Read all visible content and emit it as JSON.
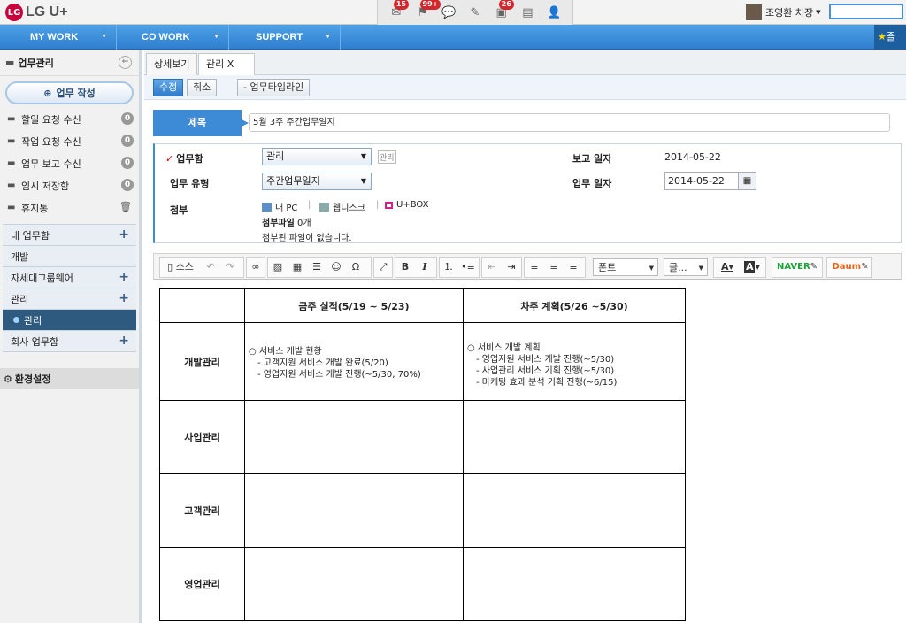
{
  "brand": {
    "logo_mark": "LG",
    "name": "LG U+"
  },
  "topicons": [
    {
      "icon": "mail-icon",
      "badge": "15"
    },
    {
      "icon": "notification-icon",
      "badge": "99+"
    },
    {
      "icon": "chat-icon",
      "badge": ""
    },
    {
      "icon": "edit-icon",
      "badge": ""
    },
    {
      "icon": "approval-icon",
      "badge": "26"
    },
    {
      "icon": "storage-icon",
      "badge": ""
    },
    {
      "icon": "add-user-icon",
      "badge": ""
    }
  ],
  "user": {
    "name": "조영환 차장"
  },
  "nav": {
    "items": [
      "MY WORK",
      "CO WORK",
      "SUPPORT"
    ],
    "fav_label": "즐"
  },
  "sidebar": {
    "title": "업무관리",
    "new_button": "업무 작성",
    "items": [
      {
        "label": "할일 요청 수신",
        "count": "0"
      },
      {
        "label": "작업 요청 수신",
        "count": "0"
      },
      {
        "label": "업무 보고 수신",
        "count": "0"
      },
      {
        "label": "임시 저장함",
        "count": "0"
      },
      {
        "label": "휴지통",
        "count": ""
      }
    ],
    "groups": [
      {
        "label": "내 업무함",
        "plus": true
      },
      {
        "label": "개발",
        "plus": false
      },
      {
        "label": "자세대그룹웨어",
        "plus": true
      },
      {
        "label": "관리",
        "plus": true
      },
      {
        "label": "관리",
        "plus": false,
        "active": true
      },
      {
        "label": "회사 업무함",
        "plus": true
      }
    ],
    "settings": "환경설정"
  },
  "tabs": [
    "상세보기",
    "관리 X"
  ],
  "actions": {
    "edit": "수정",
    "cancel": "취소",
    "timeline": "업무타임라인"
  },
  "form": {
    "title_label": "제목",
    "title_value": "5월 3주 주간업무일지",
    "inbox_label": "업무함",
    "inbox_value": "관리",
    "inbox_tag": "관리",
    "type_label": "업무 유형",
    "type_value": "주간업무일지",
    "report_date_label": "보고 일자",
    "report_date_value": "2014-05-22",
    "work_date_label": "업무 일자",
    "work_date_value": "2014-05-22",
    "attach_label": "첨부",
    "attach_sources": [
      "내 PC",
      "웹디스크",
      "U+BOX"
    ],
    "attach_count_label": "첨부파일",
    "attach_count_value": "0개",
    "attach_empty": "첨부된 파일이 없습니다."
  },
  "editor": {
    "source_label": "소스",
    "font_label": "폰트",
    "size_label": "글...",
    "naver": "NAVER",
    "daum": "Daum"
  },
  "doc": {
    "headers": [
      "",
      "금주 실적(5/19 ~ 5/23)",
      "차주 계획(5/26 ~5/30)"
    ],
    "rows": [
      {
        "label": "개발관리",
        "this_week": [
          "○ 서비스 개발 현황",
          "- 고객지원 서비스 개발 완료(5/20)",
          "- 영업지원 서비스 개발 진행(~5/30, 70%)"
        ],
        "next_week": [
          "○ 서비스 개발 계획",
          "- 영업지원 서비스 개발 진행(~5/30)",
          "- 사업관리 서비스 기획 진행(~5/30)",
          "- 마케팅 효과 분석 기획 진행(~6/15)"
        ]
      },
      {
        "label": "사업관리",
        "this_week": [],
        "next_week": []
      },
      {
        "label": "고객관리",
        "this_week": [],
        "next_week": []
      },
      {
        "label": "영업관리",
        "this_week": [],
        "next_week": []
      }
    ]
  }
}
